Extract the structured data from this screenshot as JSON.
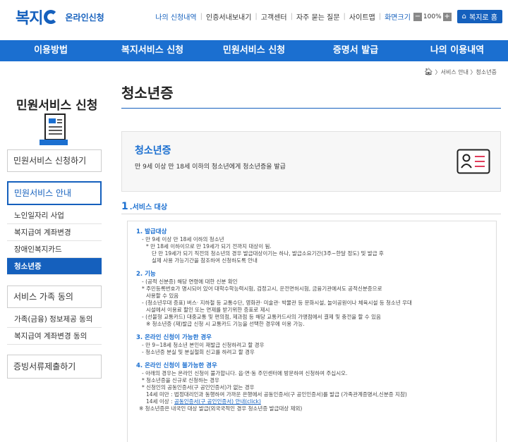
{
  "header": {
    "logo_text": "복지",
    "logo_sub": "온라인신청",
    "util_links": [
      "나의 신청내역",
      "인증서내보내기",
      "고객센터",
      "자주 묻는 질문",
      "사이트맵"
    ],
    "zoom_label": "화면크기",
    "zoom_minus": "−",
    "zoom_value": "100%",
    "zoom_plus": "+",
    "home_button": "복지로 홈"
  },
  "nav": [
    "이용방법",
    "복지서비스 신청",
    "민원서비스 신청",
    "증명서 발급",
    "나의 이용내역"
  ],
  "breadcrumb": "〉서비스 안내 〉청소년증",
  "sidebar": {
    "title": "민원서비스 신청",
    "menu1": "민원서비스 신청하기",
    "menu2": "민원서비스 안내",
    "sub_items": [
      "노인일자리 사업",
      "복지급여 계좌변경",
      "장애인복지카드",
      "청소년증"
    ],
    "menu3": "서비스 가족 동의",
    "sub_items2": [
      "가족(금융) 정보제공 동의",
      "복지급여 계좌변경 동의"
    ],
    "menu4": "증빙서류제출하기"
  },
  "main": {
    "title": "청소년증",
    "intro_title": "청소년증",
    "intro_desc": "만 9세 이상 만 18세 이하의 청소년에게 청소년증을 발급",
    "section_num": "1",
    "section_label": ".서비스 대상",
    "blocks": [
      {
        "title": "1. 발급대상",
        "lines": [
          {
            "indent": 1,
            "text": "- 만 9세 이상 만 18세 이하의 청소년"
          },
          {
            "indent": 2,
            "text": "* 만 18세 이하이므로 만 19세가 되기 전까지 대상이 됨."
          },
          {
            "indent": 3,
            "text": "단 만 19세가 되기 직전의 청소년의 경우 발급대상이기는 하나, 발급소요기간(3주~한달 정도) 및 발급 후"
          },
          {
            "indent": 3,
            "text": "실제 사용 가능기간을 참조하여 신청하도록 안내"
          }
        ]
      },
      {
        "title": "2. 기능",
        "lines": [
          {
            "indent": 1,
            "text": "- (공적 신분증) 해당 연령에 대한 신분 확인"
          },
          {
            "indent": 1,
            "text": "* 주민등록번호가 명시되어 있어 대학수학능력시험, 검정고시, 운전면허시험, 금융기관에서도 공적신분증으로"
          },
          {
            "indent": 2,
            "text": "사용할 수 있음"
          },
          {
            "indent": 1,
            "text": "- (청소년우대 증표) 버스· 지하철 등 교통수단, 영화관· 미술관· 박물관 등 문화시설, 놀이공원이나 체육시설 등 청소년 우대"
          },
          {
            "indent": 2,
            "text": "시설에서 이용료 할인 또는 면제를 받기위한 증표로 제시"
          },
          {
            "indent": 1,
            "text": "- (선불형 교통카드) 대중교통 및 편의점, 제과점 등 해당 교통카드사의 가맹점에서 결제 및 충전을 할 수 있음"
          },
          {
            "indent": 2,
            "text": "※ 청소년증 (재)발급 신청 시 교통카드 기능을 선택한 경우에 이용 가능."
          }
        ]
      },
      {
        "title": "3. 온라인 신청이 가능한 경우",
        "lines": [
          {
            "indent": 1,
            "text": "- 만 9~18세 청소년 본인이 재발급 신청하려고 할 경우"
          },
          {
            "indent": 1,
            "text": "- 청소년증 분실 및 분실철회 신고를 하려고 할 경우"
          }
        ]
      },
      {
        "title": "4. 온라인 신청이 불가능한 경우",
        "lines": [
          {
            "indent": 1,
            "text": "- 아래의 경우는 온라인 신청이 불가합니다. 읍·면·동 주민센터에 방문하여 신청하여 주십시오."
          },
          {
            "indent": 1,
            "text": "* 청소년증을 신규로 신청하는 경우"
          },
          {
            "indent": 1,
            "text": "* 신청인의 공동인증서(구 공인인증서)가 없는 경우"
          },
          {
            "indent": 2,
            "text": "14세 미만 : 법정대리인과 동행하여 가까운 은행에서 공동인증서(구 공인인증서)를 발급 (가족관계증명서,신분증 지참)"
          }
        ],
        "link_line_prefix": "14세 이상 : ",
        "link_text": "공동인증서(구 공인인증서) 안내(click)",
        "note": "※ 청소년증은 내국인 대상 발급(외국국적인 경우 청소년증 발급대상 제외)"
      }
    ]
  },
  "colors": {
    "primary": "#1b6fd0",
    "dark_blue": "#1560bd"
  }
}
